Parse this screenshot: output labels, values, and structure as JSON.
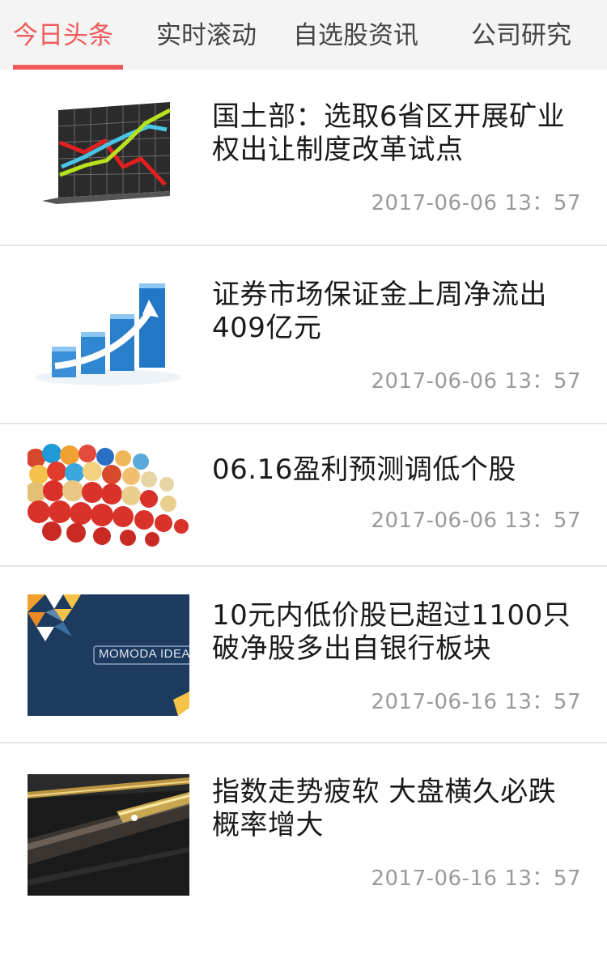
{
  "tabs": [
    {
      "label": "今日头条",
      "active": true
    },
    {
      "label": "实时滚动",
      "active": false
    },
    {
      "label": "自选股资讯",
      "active": false
    },
    {
      "label": "公司研究",
      "active": false
    }
  ],
  "accent_color": "#f05a5a",
  "news": [
    {
      "title": "国土部：选取6省区开展矿业权出让制度改革试点",
      "time": "2017-06-06 13：57",
      "thumb_icon": "line-chart-image"
    },
    {
      "title": "证券市场保证金上周净流出409亿元",
      "time": "2017-06-06 13：57",
      "thumb_icon": "bar-chart-arrow-image"
    },
    {
      "title": "06.16盈利预测调低个股",
      "time": "2017-06-06 13：57",
      "thumb_icon": "puzzle-pieces-image"
    },
    {
      "title": "10元内低价股已超过1100只 破净股多出自银行板块",
      "time": "2017-06-16 13：57",
      "thumb_icon": "momoda-ideas-image",
      "thumb_text": "MOMODA IDEA"
    },
    {
      "title": "指数走势疲软 大盘横久必跌 概率增大",
      "time": "2017-06-16 13：57",
      "thumb_icon": "pens-image"
    }
  ]
}
